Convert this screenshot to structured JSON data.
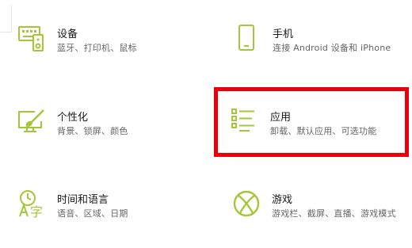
{
  "colors": {
    "accent": "#a4c639",
    "highlight": "#e8000b",
    "title": "#1a1a1a",
    "desc": "#666666"
  },
  "tiles": [
    {
      "id": "devices",
      "icon": "keyboard-icon",
      "title": "设备",
      "desc": "蓝牙、打印机、鼠标"
    },
    {
      "id": "phone",
      "icon": "phone-icon",
      "title": "手机",
      "desc": "连接 Android 设备和 iPhone"
    },
    {
      "id": "personalization",
      "icon": "paintbrush-icon",
      "title": "个性化",
      "desc": "背景、锁屏、颜色"
    },
    {
      "id": "apps",
      "icon": "app-list-icon",
      "title": "应用",
      "desc": "卸载、默认应用、可选功能"
    },
    {
      "id": "time-language",
      "icon": "time-language-icon",
      "title": "时间和语言",
      "desc": "语音、区域、日期"
    },
    {
      "id": "gaming",
      "icon": "xbox-icon",
      "title": "游戏",
      "desc": "游戏栏、截屏、直播、游戏模式"
    }
  ],
  "highlighted_tile": "apps"
}
